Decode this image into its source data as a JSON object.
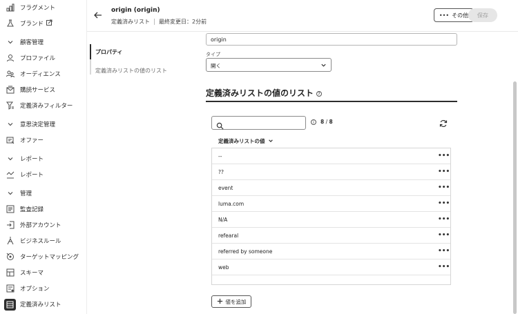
{
  "sidebar": {
    "items": [
      {
        "label": "フラグメント",
        "icon": "fragments-icon"
      },
      {
        "label": "ブランド",
        "icon": "brand-icon",
        "external": true
      },
      {
        "label": "顧客管理",
        "icon": "chevron-down-icon",
        "section": true
      },
      {
        "label": "プロファイル",
        "icon": "profile-icon"
      },
      {
        "label": "オーディエンス",
        "icon": "audience-icon"
      },
      {
        "label": "購読サービス",
        "icon": "subscription-icon"
      },
      {
        "label": "定義済みフィルター",
        "icon": "filter-icon"
      },
      {
        "label": "意思決定管理",
        "icon": "chevron-down-icon",
        "section": true
      },
      {
        "label": "オファー",
        "icon": "offer-icon"
      },
      {
        "label": "レポート",
        "icon": "chevron-down-icon",
        "section": true
      },
      {
        "label": "レポート",
        "icon": "report-icon"
      },
      {
        "label": "管理",
        "icon": "chevron-down-icon",
        "section": true
      },
      {
        "label": "監査記録",
        "icon": "audit-icon"
      },
      {
        "label": "外部アカウント",
        "icon": "external-account-icon"
      },
      {
        "label": "ビジネスルール",
        "icon": "business-rule-icon"
      },
      {
        "label": "ターゲットマッピング",
        "icon": "target-mapping-icon"
      },
      {
        "label": "スキーマ",
        "icon": "schema-icon"
      },
      {
        "label": "オプション",
        "icon": "options-icon"
      },
      {
        "label": "定義済みリスト",
        "icon": "enumeration-icon",
        "active": true
      }
    ]
  },
  "header": {
    "title": "origin (origin)",
    "breadcrumb": "定義済みリスト",
    "modified": "最終変更日：2分前",
    "more_label": "その他",
    "save_label": "保存"
  },
  "panel": {
    "items": [
      "プロパティ",
      "定義済みリストの値のリスト"
    ]
  },
  "form": {
    "name_value": "origin",
    "type_label": "タイプ",
    "type_value": "開く"
  },
  "values": {
    "title": "定義済みリストの値のリスト",
    "count_shown": "8",
    "count_total": "8",
    "column_header": "定義済みリストの値",
    "rows": [
      "--",
      "??",
      "event",
      "luma.com",
      "N/A",
      "refearal",
      "referred by someone",
      "web"
    ],
    "add_label": "値を追加"
  }
}
